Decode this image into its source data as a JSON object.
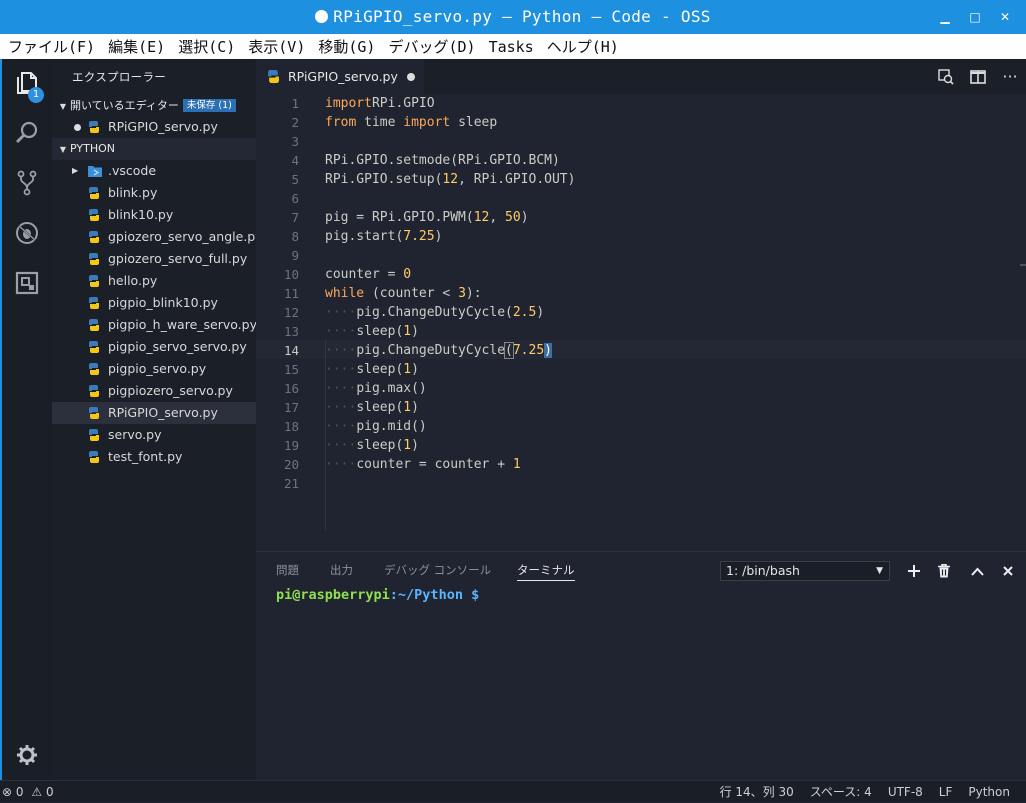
{
  "window": {
    "title": "RPiGPIO_servo.py — Python — Code - OSS",
    "minimize": "▁",
    "maximize": "□",
    "close": "✕"
  },
  "menu": [
    "ファイル(F)",
    "編集(E)",
    "選択(C)",
    "表示(V)",
    "移動(G)",
    "デバッグ(D)",
    "Tasks",
    "ヘルプ(H)"
  ],
  "activity": {
    "explorer_badge": "1"
  },
  "sidebar": {
    "title": "エクスプローラー",
    "open_editors_label": "開いているエディター",
    "unsaved_badge": "未保存 (1)",
    "open_editors": [
      {
        "name": "RPiGPIO_servo.py"
      }
    ],
    "folder_label": "PYTHON",
    "files": [
      {
        "name": ".vscode",
        "type": "folder"
      },
      {
        "name": "blink.py",
        "type": "py"
      },
      {
        "name": "blink10.py",
        "type": "py"
      },
      {
        "name": "gpiozero_servo_angle.py",
        "type": "py"
      },
      {
        "name": "gpiozero_servo_full.py",
        "type": "py"
      },
      {
        "name": "hello.py",
        "type": "py"
      },
      {
        "name": "pigpio_blink10.py",
        "type": "py"
      },
      {
        "name": "pigpio_h_ware_servo.py",
        "type": "py"
      },
      {
        "name": "pigpio_servo_servo.py",
        "type": "py"
      },
      {
        "name": "pigpio_servo.py",
        "type": "py"
      },
      {
        "name": "pigpiozero_servo.py",
        "type": "py"
      },
      {
        "name": "RPiGPIO_servo.py",
        "type": "py",
        "selected": true
      },
      {
        "name": "servo.py",
        "type": "py"
      },
      {
        "name": "test_font.py",
        "type": "py"
      }
    ]
  },
  "editor": {
    "tab_label": "RPiGPIO_servo.py",
    "lines": [
      [
        [
          "kw",
          "import"
        ],
        [
          "",
          "RPi.GPIO"
        ]
      ],
      [
        [
          "kw",
          "from"
        ],
        [
          "",
          " time "
        ],
        [
          "kw",
          "import"
        ],
        [
          "",
          " sleep"
        ]
      ],
      [],
      [
        [
          "",
          "RPi.GPIO.setmode(RPi.GPIO.BCM)"
        ]
      ],
      [
        [
          "",
          "RPi.GPIO.setup("
        ],
        [
          "num",
          "12"
        ],
        [
          "",
          ", RPi.GPIO.OUT)"
        ]
      ],
      [],
      [
        [
          "",
          "pig = RPi.GPIO.PWM("
        ],
        [
          "num",
          "12"
        ],
        [
          "",
          ", "
        ],
        [
          "num",
          "50"
        ],
        [
          "",
          ")"
        ]
      ],
      [
        [
          "",
          "pig.start("
        ],
        [
          "num",
          "7.25"
        ],
        [
          "",
          ")"
        ]
      ],
      [],
      [
        [
          "",
          "counter = "
        ],
        [
          "num",
          "0"
        ]
      ],
      [
        [
          "kw",
          "while"
        ],
        [
          "",
          " (counter < "
        ],
        [
          "num",
          "3"
        ],
        [
          "",
          "):"
        ]
      ],
      [
        [
          "ws",
          "····"
        ],
        [
          "",
          "pig.ChangeDutyCycle("
        ],
        [
          "num",
          "2.5"
        ],
        [
          "",
          ")"
        ]
      ],
      [
        [
          "ws",
          "····"
        ],
        [
          "",
          "sleep("
        ],
        [
          "num",
          "1"
        ],
        [
          "",
          ")"
        ]
      ],
      [
        [
          "ws",
          "····"
        ],
        [
          "",
          "pig.ChangeDutyCycle"
        ],
        [
          "cur",
          "("
        ],
        [
          "num",
          "7.25"
        ],
        [
          "curbg",
          ")"
        ]
      ],
      [
        [
          "ws",
          "····"
        ],
        [
          "",
          "sleep("
        ],
        [
          "num",
          "1"
        ],
        [
          "",
          ")"
        ]
      ],
      [
        [
          "ws",
          "····"
        ],
        [
          "",
          "pig.max()"
        ]
      ],
      [
        [
          "ws",
          "····"
        ],
        [
          "",
          "sleep("
        ],
        [
          "num",
          "1"
        ],
        [
          "",
          ")"
        ]
      ],
      [
        [
          "ws",
          "····"
        ],
        [
          "",
          "pig.mid()"
        ]
      ],
      [
        [
          "ws",
          "····"
        ],
        [
          "",
          "sleep("
        ],
        [
          "num",
          "1"
        ],
        [
          "",
          ")"
        ]
      ],
      [
        [
          "ws",
          "····"
        ],
        [
          "",
          "counter = counter + "
        ],
        [
          "num",
          "1"
        ]
      ],
      []
    ]
  },
  "panel": {
    "tabs": [
      "問題",
      "出力",
      "デバッグ コンソール",
      "ターミナル"
    ],
    "active_tab": 3,
    "terminal_select": "1: /bin/bash",
    "prompt_user": "pi@raspberrypi",
    "prompt_path": ":~/Python $"
  },
  "status": {
    "errors": "0",
    "warnings": "0",
    "position": "行 14、列 30",
    "spaces": "スペース: 4",
    "encoding": "UTF-8",
    "eol": "LF",
    "language": "Python"
  }
}
